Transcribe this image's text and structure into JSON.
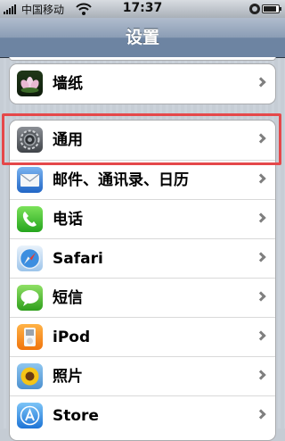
{
  "status_bar": {
    "carrier": "中国移动",
    "time": "17:37",
    "battery_level": 0.85
  },
  "nav_bar": {
    "title": "设置"
  },
  "settings": {
    "wallpaper": {
      "label": "墙纸",
      "icon": "wallpaper-flower-icon"
    },
    "items": [
      {
        "label": "通用",
        "icon": "gear-icon"
      },
      {
        "label": "邮件、通讯录、日历",
        "icon": "mail-envelope-icon"
      },
      {
        "label": "电话",
        "icon": "phone-icon"
      },
      {
        "label": "Safari",
        "icon": "safari-compass-icon"
      },
      {
        "label": "短信",
        "icon": "messages-bubble-icon"
      },
      {
        "label": "iPod",
        "icon": "ipod-icon"
      },
      {
        "label": "照片",
        "icon": "photos-sunflower-icon"
      },
      {
        "label": "Store",
        "icon": "app-store-icon"
      }
    ]
  },
  "colors": {
    "highlight": "#e5484a",
    "nav_bar": "#6d84a2"
  }
}
